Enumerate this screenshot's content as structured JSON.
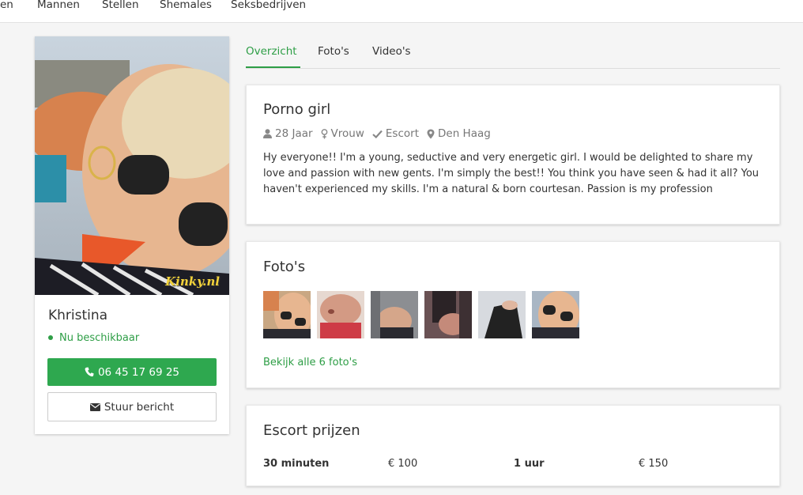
{
  "topnav": {
    "items": [
      "en",
      "Mannen",
      "Stellen",
      "Shemales",
      "Seksbedrijven"
    ]
  },
  "profile": {
    "name": "Khristina",
    "availability": "Nu beschikbaar",
    "phone": "06 45 17 69 25",
    "message_label": "Stuur bericht",
    "watermark": "Kinky.nl"
  },
  "tabs": [
    "Overzicht",
    "Foto's",
    "Video's"
  ],
  "overview": {
    "title": "Porno girl",
    "age": "28 Jaar",
    "gender": "Vrouw",
    "category": "Escort",
    "city": "Den Haag",
    "description": "Hy everyone!! I'm a young, seductive and very energetic girl. I would be delighted to share my love and passion with new gents. I'm simply the best!! You think you have seen & had it all? You haven't experienced my skills. I'm a natural & born courtesan. Passion is my profession"
  },
  "photos": {
    "title": "Foto's",
    "see_all": "Bekijk alle 6 foto's"
  },
  "prices": {
    "title": "Escort prijzen",
    "rows": [
      {
        "duration": "30 minuten",
        "price": "€ 100"
      },
      {
        "duration": "1 uur",
        "price": "€ 150"
      }
    ]
  },
  "colors": {
    "accent": "#2e9e46",
    "phone_button": "#2ea84f"
  },
  "icons": [
    "user-icon",
    "venus-icon",
    "check-icon",
    "map-marker-icon",
    "phone-icon",
    "envelope-icon"
  ]
}
